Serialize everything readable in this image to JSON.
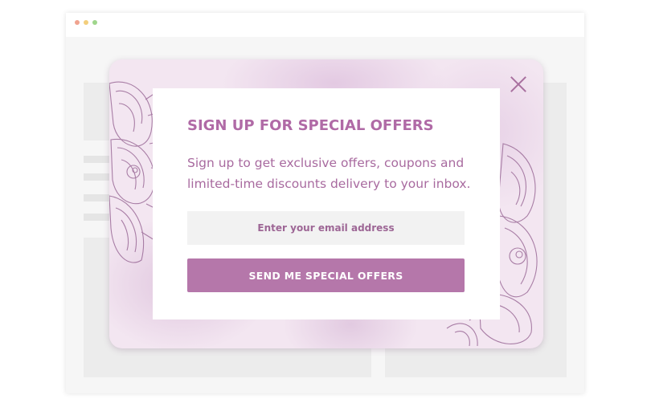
{
  "browser": {
    "window_dots": [
      "red-dot",
      "yellow-dot",
      "green-dot"
    ]
  },
  "popup": {
    "title": "SIGN UP FOR SPECIAL OFFERS",
    "description": "Sign up to get exclusive offers, coupons and limited-time discounts delivery to your inbox.",
    "email_placeholder": "Enter your email address",
    "submit_label": "SEND ME SPECIAL OFFERS",
    "close_icon": "close-icon",
    "decoration": "floral-illustration"
  },
  "colors": {
    "accent": "#b577aa",
    "title": "#b06aa6",
    "text": "#a86a9f",
    "input_bg": "#f2f2f2",
    "watercolor": "#f3e6f1"
  }
}
